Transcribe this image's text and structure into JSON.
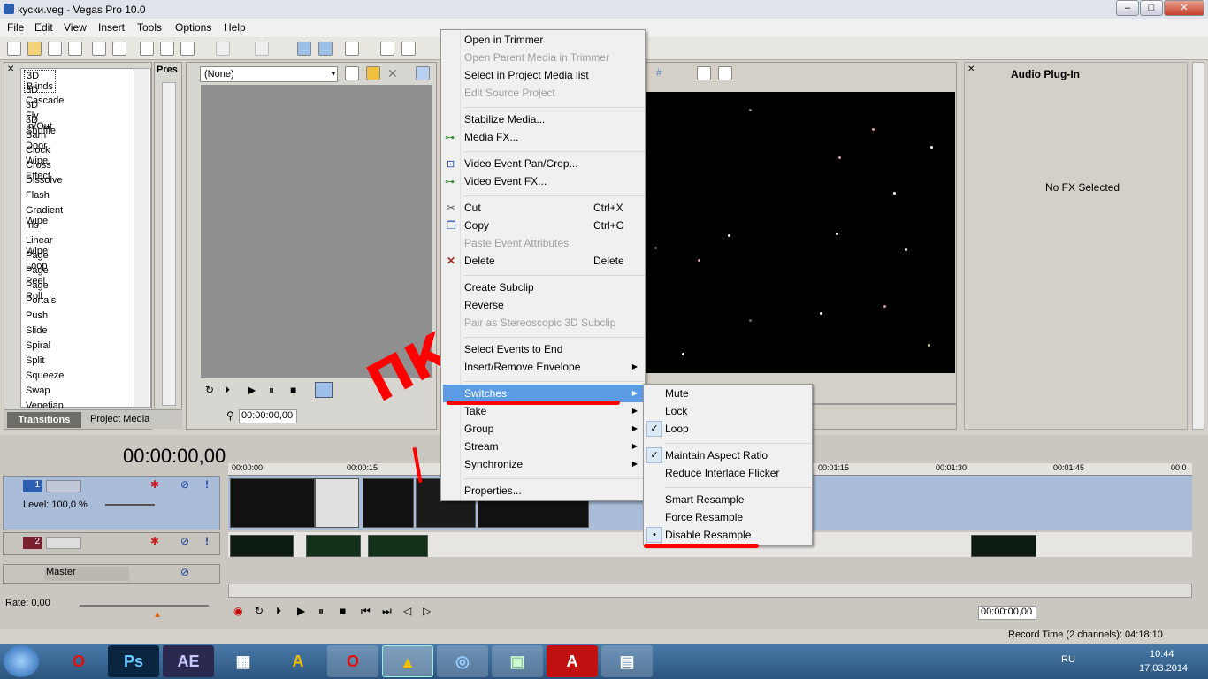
{
  "window": {
    "title": "куски.veg - Vegas Pro 10.0",
    "min": "–",
    "max": "□",
    "close": "✕"
  },
  "menu": [
    "File",
    "Edit",
    "View",
    "Insert",
    "Tools",
    "Options",
    "Help"
  ],
  "transitions": {
    "items": [
      "3D Blinds",
      "3D Cascade",
      "3D Fly In/Out",
      "3D Shuffle",
      "Barn Door",
      "Clock Wipe",
      "Cross Effect",
      "Dissolve",
      "Flash",
      "Gradient Wipe",
      "Iris",
      "Linear Wipe",
      "Page Loop",
      "Page Peel",
      "Page Roll",
      "Portals",
      "Push",
      "Slide",
      "Spiral",
      "Split",
      "Squeeze",
      "Swap",
      "Venetian Blinds"
    ],
    "selected": "3D Blinds",
    "presets_label": "Pres"
  },
  "tabs": {
    "transitions": "Transitions",
    "project_media": "Project Media"
  },
  "trimmer": {
    "dropdown": "(None)",
    "timecode": "00:00:00,00"
  },
  "audio_plugin": {
    "title": "Audio Plug-In",
    "empty": "No FX Selected"
  },
  "timeline": {
    "big_timecode": "00:00:00,00",
    "ruler": [
      "00:00:00",
      "00:00:15",
      "00:01:15",
      "00:01:30",
      "00:01:45",
      "00:0"
    ],
    "track1": {
      "num": "1",
      "level": "Level: 100,0 %"
    },
    "track2": {
      "num": "2"
    },
    "master": "Master",
    "rate": "Rate: 0,00",
    "cursor_tc": "00:00:00,00",
    "record_time": "Record Time (2 channels): 04:18:10"
  },
  "context_menu": {
    "items": [
      {
        "label": "Open in Trimmer",
        "disabled": false
      },
      {
        "label": "Open Parent Media in Trimmer",
        "disabled": true
      },
      {
        "label": "Select in Project Media list",
        "disabled": false
      },
      {
        "label": "Edit Source Project",
        "disabled": true
      },
      {
        "label": "Stabilize Media...",
        "disabled": false
      },
      {
        "label": "Media FX...",
        "disabled": false
      },
      {
        "label": "Video Event Pan/Crop...",
        "disabled": false
      },
      {
        "label": "Video Event FX...",
        "disabled": false
      },
      {
        "label": "Cut",
        "shortcut": "Ctrl+X",
        "disabled": false
      },
      {
        "label": "Copy",
        "shortcut": "Ctrl+C",
        "disabled": false
      },
      {
        "label": "Paste Event Attributes",
        "disabled": true
      },
      {
        "label": "Delete",
        "shortcut": "Delete",
        "disabled": false
      },
      {
        "label": "Create Subclip",
        "disabled": false
      },
      {
        "label": "Reverse",
        "disabled": false
      },
      {
        "label": "Pair as Stereoscopic 3D Subclip",
        "disabled": true
      },
      {
        "label": "Select Events to End",
        "disabled": false
      },
      {
        "label": "Insert/Remove Envelope",
        "disabled": false
      },
      {
        "label": "Switches",
        "disabled": false
      },
      {
        "label": "Take",
        "disabled": false
      },
      {
        "label": "Group",
        "disabled": false
      },
      {
        "label": "Stream",
        "disabled": false
      },
      {
        "label": "Synchronize",
        "disabled": false
      },
      {
        "label": "Properties...",
        "disabled": false
      }
    ]
  },
  "switches_menu": {
    "items": [
      {
        "label": "Mute",
        "checked": false
      },
      {
        "label": "Lock",
        "checked": false
      },
      {
        "label": "Loop",
        "checked": true
      },
      {
        "label": "Maintain Aspect Ratio",
        "checked": true
      },
      {
        "label": "Reduce Interlace Flicker",
        "checked": false
      },
      {
        "label": "Smart Resample",
        "checked": false
      },
      {
        "label": "Force Resample",
        "checked": false
      },
      {
        "label": "Disable Resample",
        "radio": true
      }
    ]
  },
  "taskbar": {
    "lang": "RU",
    "time": "10:44",
    "date": "17.03.2014"
  },
  "colors": {
    "highlight": "#5b9be6",
    "annotation": "#ff0000"
  },
  "annotation_text": "ПКМ"
}
